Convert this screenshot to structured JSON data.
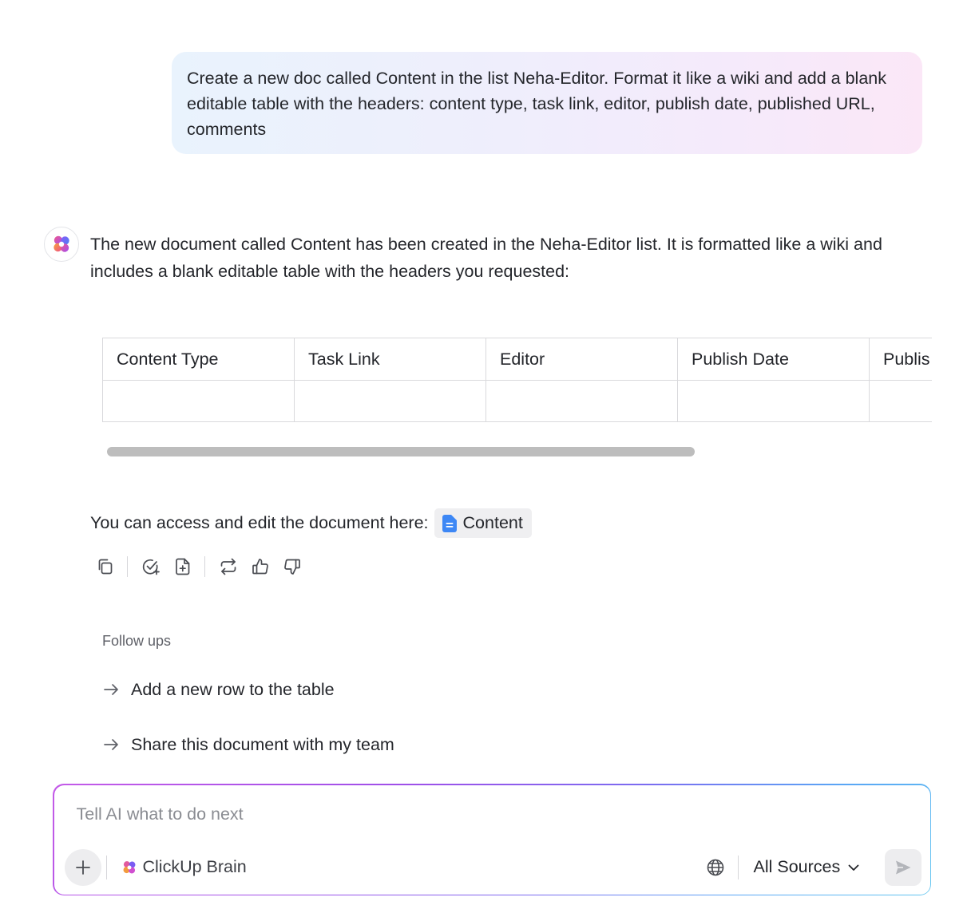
{
  "user_message": {
    "text": "Create a new doc called Content in the list Neha-Editor. Format it like a wiki and add a blank editable table with the headers: content type, task link, editor, publish date, published URL, comments"
  },
  "ai_response": {
    "avatar_icon": "clickup-brain-logo-icon",
    "text": "The new document called Content has been created in the Neha-Editor list. It is formatted like a wiki and includes a blank editable table with the headers you requested:",
    "table": {
      "headers": [
        "Content Type",
        "Task Link",
        "Editor",
        "Publish Date",
        "Publis"
      ],
      "rows": [
        [
          "",
          "",
          "",
          "",
          ""
        ]
      ]
    },
    "scroll_position": 0.0,
    "access_text": "You can access and edit the document here:",
    "doc_link": {
      "label": "Content",
      "icon": "document-icon",
      "icon_color": "#3d87f5"
    },
    "actions": [
      {
        "name": "copy-icon"
      },
      {
        "name": "create-task-icon"
      },
      {
        "name": "create-doc-icon"
      },
      {
        "name": "regenerate-icon"
      },
      {
        "name": "thumbs-up-icon"
      },
      {
        "name": "thumbs-down-icon"
      }
    ]
  },
  "followups": {
    "title": "Follow ups",
    "items": [
      {
        "label": "Add a new row to the table"
      },
      {
        "label": "Share this document with my team"
      }
    ]
  },
  "composer": {
    "placeholder": "Tell AI what to do next",
    "value": "",
    "brain_label": "ClickUp Brain",
    "sources_label": "All Sources",
    "icons": [
      "plus-icon",
      "globe-icon",
      "chevron-down-icon",
      "send-icon"
    ]
  },
  "colors": {
    "bubble_gradient": [
      "#e9f3fd",
      "#fbe7f7"
    ],
    "input_border_gradient": [
      "#c45be8",
      "#63c6f0"
    ],
    "doc_icon": "#3d87f5"
  }
}
